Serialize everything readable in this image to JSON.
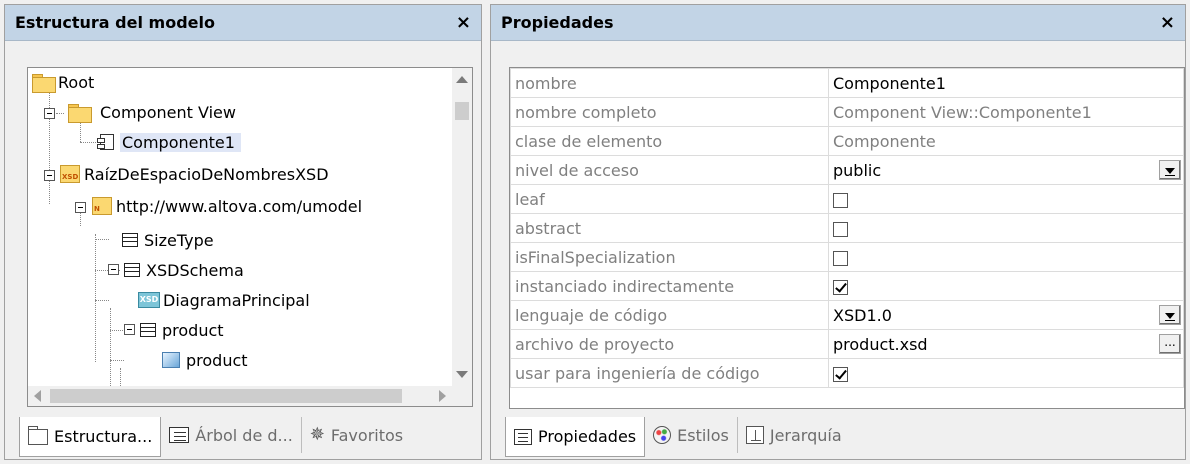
{
  "left_panel": {
    "title": "Estructura del modelo",
    "close_glyph": "×",
    "tree": [
      {
        "label": "Root",
        "icon": "folder-icon"
      },
      {
        "label": "Component View",
        "icon": "folder-icon"
      },
      {
        "label": "Componente1",
        "icon": "component-icon",
        "selected": true
      },
      {
        "label": "RaízDeEspacioDeNombresXSD",
        "icon": "xsd-package-icon",
        "icon_text": "XSD"
      },
      {
        "label": "http://www.altova.com/umodel",
        "icon": "namespace-package-icon",
        "icon_text": "N"
      },
      {
        "label": "SizeType",
        "icon": "class-icon"
      },
      {
        "label": "XSDSchema",
        "icon": "class-icon"
      },
      {
        "label": "DiagramaPrincipal",
        "icon": "xsd-diagram-icon",
        "icon_text": "XSD"
      },
      {
        "label": "product",
        "icon": "class-icon"
      },
      {
        "label": "product",
        "icon": "element-icon"
      }
    ],
    "tabs": [
      {
        "label": "Estructura...",
        "icon": "folder-outline-icon",
        "active": true
      },
      {
        "label": "Árbol de d...",
        "icon": "diagram-tree-icon",
        "active": false
      },
      {
        "label": "Favoritos",
        "icon": "favorites-star-icon",
        "active": false
      }
    ]
  },
  "right_panel": {
    "title": "Propiedades",
    "close_glyph": "×",
    "properties": [
      {
        "name": "nombre",
        "value": "Componente1",
        "kind": "text"
      },
      {
        "name": "nombre completo",
        "value": "Component View::Componente1",
        "kind": "readonly"
      },
      {
        "name": "clase de elemento",
        "value": "Componente",
        "kind": "readonly"
      },
      {
        "name": "nivel de acceso",
        "value": "public",
        "kind": "dropdown"
      },
      {
        "name": "leaf",
        "checked": false,
        "kind": "checkbox"
      },
      {
        "name": "abstract",
        "checked": false,
        "kind": "checkbox"
      },
      {
        "name": "isFinalSpecialization",
        "checked": false,
        "kind": "checkbox"
      },
      {
        "name": "instanciado indirectamente",
        "checked": true,
        "kind": "checkbox"
      },
      {
        "name": "lenguaje de código",
        "value": "XSD1.0",
        "kind": "dropdown"
      },
      {
        "name": "archivo de proyecto",
        "value": "product.xsd",
        "kind": "ellipsis",
        "button_label": "..."
      },
      {
        "name": "usar para ingeniería de código",
        "checked": true,
        "kind": "checkbox"
      }
    ],
    "tabs": [
      {
        "label": "Propiedades",
        "icon": "properties-icon",
        "active": true
      },
      {
        "label": "Estilos",
        "icon": "styles-palette-icon",
        "active": false
      },
      {
        "label": "Jerarquía",
        "icon": "hierarchy-icon",
        "active": false
      }
    ]
  },
  "colors": {
    "header_bg": "#c2d4e6",
    "selection_bg": "#dfe6f6",
    "folder_yellow": "#fbd871"
  }
}
